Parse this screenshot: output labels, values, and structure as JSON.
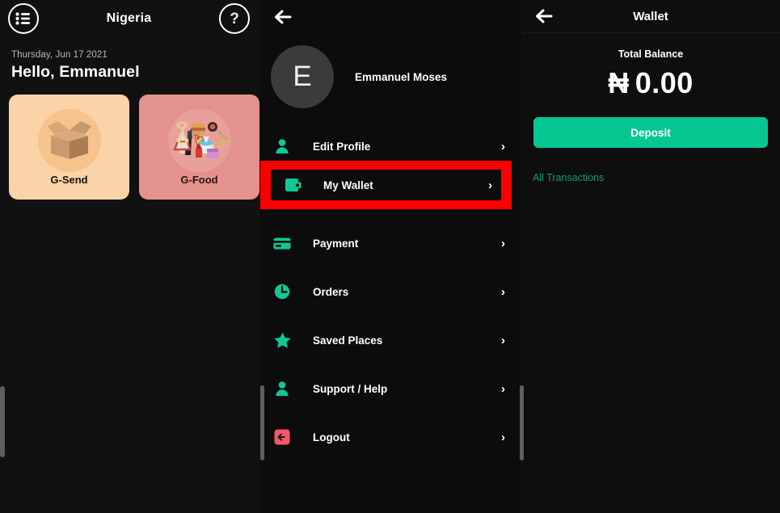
{
  "home": {
    "menu_icon": "list-menu-icon",
    "title": "Nigeria",
    "help_label": "?",
    "date": "Thursday, Jun 17 2021",
    "greeting": "Hello, Emmanuel",
    "cards": [
      {
        "label": "G-Send",
        "icon": "cardboard-box-icon",
        "bg": "#fad3a8",
        "art_bg": "#f7c38c"
      },
      {
        "label": "G-Food",
        "icon": "food-platter-icon",
        "bg": "#e3928d",
        "art_bg": "#e8a09b"
      }
    ]
  },
  "menu": {
    "back_icon": "back-arrow-icon",
    "avatar_initial": "E",
    "profile_name": "Emmanuel Moses",
    "items": [
      {
        "label": "Edit Profile",
        "icon": "person-icon",
        "chevron": "›"
      },
      {
        "label": "My Wallet",
        "icon": "wallet-icon",
        "chevron": "›"
      },
      {
        "label": "Payment",
        "icon": "card-icon",
        "chevron": "›"
      },
      {
        "label": "Orders",
        "icon": "clock-icon",
        "chevron": "›"
      },
      {
        "label": "Saved Places",
        "icon": "star-icon",
        "chevron": "›"
      },
      {
        "label": "Support / Help",
        "icon": "person-icon",
        "chevron": "›"
      },
      {
        "label": "Logout",
        "icon": "logout-icon",
        "chevron": "›"
      }
    ],
    "highlight_color": "#fb0000",
    "highlighted_item": "My Wallet"
  },
  "wallet": {
    "back_icon": "back-arrow-icon",
    "title": "Wallet",
    "balance_caption": "Total Balance",
    "currency_symbol": "₦",
    "balance": "0.00",
    "deposit_label": "Deposit",
    "all_transactions_label": "All Transactions",
    "accent_color": "#06c792",
    "link_color": "#0f9e72"
  }
}
